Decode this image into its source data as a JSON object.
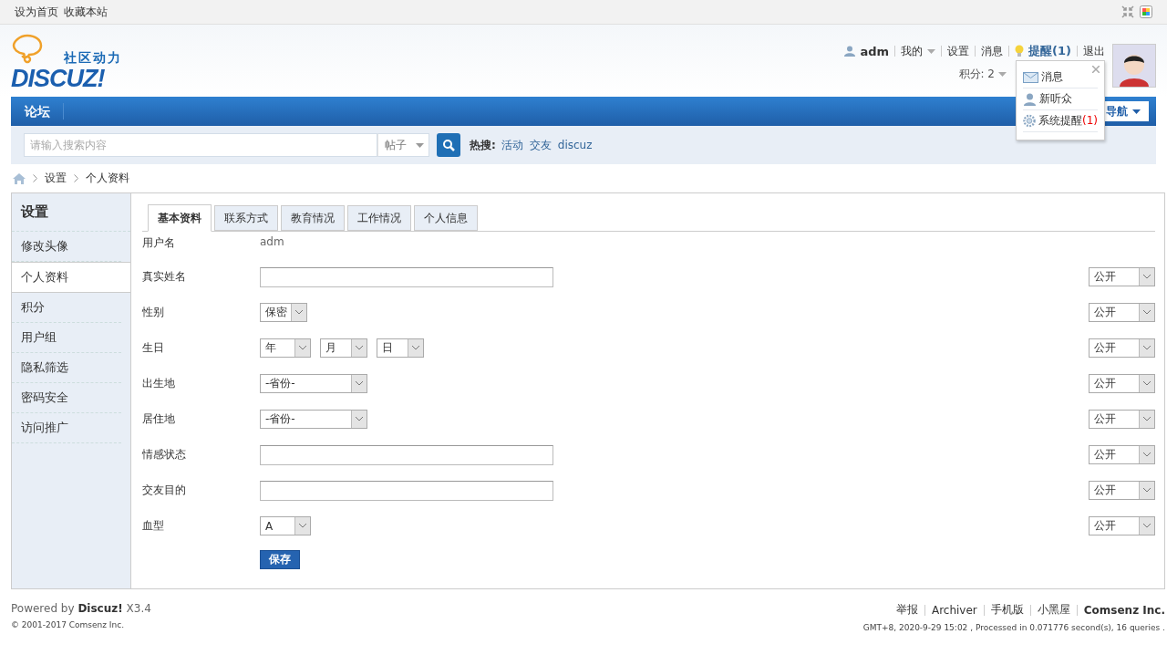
{
  "top_links": [
    "设为首页",
    "收藏本站"
  ],
  "logo": {
    "slogan": "社区动力",
    "wordmark": "DISCUZ!"
  },
  "user_bar": {
    "username": "adm",
    "links": [
      {
        "label": "我的",
        "kind": "menu"
      },
      {
        "label": "设置",
        "kind": "link"
      },
      {
        "label": "消息",
        "kind": "link"
      },
      {
        "label": "提醒(1)",
        "kind": "alert"
      },
      {
        "label": "退出",
        "kind": "link"
      }
    ],
    "credits": "积分: 2"
  },
  "notice_popup": {
    "items": [
      {
        "label": "消息",
        "kind": "mail"
      },
      {
        "label": "新听众",
        "kind": "user"
      },
      {
        "label": "系统提醒",
        "kind": "gear",
        "count": "(1)"
      }
    ]
  },
  "nav": {
    "items": [
      "论坛"
    ],
    "quick_nav": "导航"
  },
  "search": {
    "placeholder": "请输入搜索内容",
    "scope": "帖子",
    "hot_label": "热搜:",
    "hot_terms": [
      "活动",
      "交友",
      "discuz"
    ]
  },
  "breadcrumb": [
    "设置",
    "个人资料"
  ],
  "sidebar": {
    "title": "设置",
    "items": [
      {
        "label": "修改头像",
        "selected": false
      },
      {
        "label": "个人资料",
        "selected": true
      },
      {
        "label": "积分",
        "selected": false
      },
      {
        "label": "用户组",
        "selected": false
      },
      {
        "label": "隐私筛选",
        "selected": false
      },
      {
        "label": "密码安全",
        "selected": false
      },
      {
        "label": "访问推广",
        "selected": false
      }
    ]
  },
  "tabs": [
    {
      "label": "基本资料",
      "selected": true
    },
    {
      "label": "联系方式",
      "selected": false
    },
    {
      "label": "教育情况",
      "selected": false
    },
    {
      "label": "工作情况",
      "selected": false
    },
    {
      "label": "个人信息",
      "selected": false
    }
  ],
  "form": {
    "rows": [
      {
        "label": "用户名",
        "kind": "text",
        "value": "adm"
      },
      {
        "label": "真实姓名",
        "kind": "input",
        "privacy": "公开"
      },
      {
        "label": "性别",
        "kind": "select",
        "selects": [
          {
            "value": "保密",
            "kind": "short"
          }
        ],
        "privacy": "公开"
      },
      {
        "label": "生日",
        "kind": "select",
        "selects": [
          {
            "value": "年",
            "kind": "medium"
          },
          {
            "value": "月",
            "kind": "short"
          },
          {
            "value": "日",
            "kind": "short"
          }
        ],
        "privacy": "公开"
      },
      {
        "label": "出生地",
        "kind": "select",
        "selects": [
          {
            "value": "-省份-",
            "kind": "long"
          }
        ],
        "privacy": "公开"
      },
      {
        "label": "居住地",
        "kind": "select",
        "selects": [
          {
            "value": "-省份-",
            "kind": "long"
          }
        ],
        "privacy": "公开"
      },
      {
        "label": "情感状态",
        "kind": "input",
        "privacy": "公开"
      },
      {
        "label": "交友目的",
        "kind": "input",
        "privacy": "公开"
      },
      {
        "label": "血型",
        "kind": "select",
        "selects": [
          {
            "value": "A",
            "kind": "medium"
          }
        ],
        "privacy": "公开"
      }
    ],
    "submit": "保存"
  },
  "footer": {
    "powered_prefix": "Powered by",
    "powered_brand": "Discuz!",
    "version": "X3.4",
    "copyright": "© 2001-2017 Comsenz Inc.",
    "links": [
      "举报",
      "Archiver",
      "手机版",
      "小黑屋"
    ],
    "company": "Comsenz Inc.",
    "stats": "GMT+8, 2020-9-29 15:02 , Processed in 0.071776 second(s), 16 queries ."
  }
}
